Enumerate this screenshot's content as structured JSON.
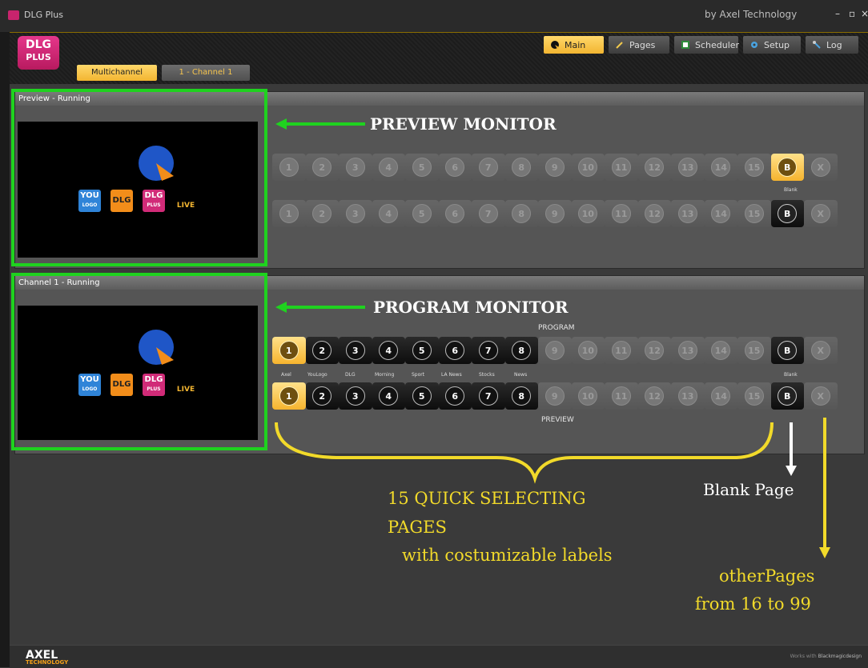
{
  "window": {
    "title": "DLG Plus",
    "by_text": "by Axel Technology",
    "min_btn": "–",
    "max_btn": "▫",
    "close_btn": "×"
  },
  "logo": {
    "line1": "DLG",
    "line2": "PLUS"
  },
  "channel_tabs": [
    "Multichannel",
    "1 - Channel 1"
  ],
  "nav": [
    "Main",
    "Pages",
    "Scheduler",
    "Setup",
    "Log"
  ],
  "preview_panel": {
    "header": "Preview - Running",
    "row1": [
      "1",
      "2",
      "3",
      "4",
      "5",
      "6",
      "7",
      "8",
      "9",
      "10",
      "11",
      "12",
      "13",
      "14",
      "15",
      "B",
      "X"
    ],
    "row2": [
      "1",
      "2",
      "3",
      "4",
      "5",
      "6",
      "7",
      "8",
      "9",
      "10",
      "11",
      "12",
      "13",
      "14",
      "15",
      "B",
      "X"
    ],
    "blank_label": "Blank"
  },
  "program_panel": {
    "header": "Channel 1 - Running",
    "program_title": "PROGRAM",
    "preview_title": "PREVIEW",
    "row1": [
      "1",
      "2",
      "3",
      "4",
      "5",
      "6",
      "7",
      "8",
      "9",
      "10",
      "11",
      "12",
      "13",
      "14",
      "15",
      "B",
      "X"
    ],
    "row2": [
      "1",
      "2",
      "3",
      "4",
      "5",
      "6",
      "7",
      "8",
      "9",
      "10",
      "11",
      "12",
      "13",
      "14",
      "15",
      "B",
      "X"
    ],
    "page_labels": [
      "Axel",
      "YouLogo",
      "DLG",
      "Morning",
      "Sport",
      "LA News",
      "Stocks",
      "News"
    ],
    "blank_label": "Blank"
  },
  "monitor_logos": {
    "you_logo": "YOU",
    "you_logo_sub": "LOGO",
    "dlg": "DLG",
    "dlg_plus": "DLG",
    "dlg_plus_sub": "PLUS",
    "live": "LIVE"
  },
  "annotations": {
    "preview_monitor": "PREVIEW MONITOR",
    "program_monitor": "PROGRAM MONITOR",
    "quick_pages_1": "15 QUICK SELECTING",
    "quick_pages_2": "PAGES",
    "quick_pages_3": "with costumizable labels",
    "blank_page": "Blank Page",
    "other_pages_1": "otherPages",
    "other_pages_2": "from 16 to 99"
  },
  "footer": {
    "brand": "AXEL",
    "brand_sub": "TECHNOLOGY",
    "works_with": "Works with",
    "works_brand": "Blackmagicdesign"
  },
  "colors": {
    "accent_yellow": "#f2b531",
    "annotation_green": "#1fd21f",
    "annotation_yellow": "#f2da2a",
    "dlg_pink": "#d12b78"
  }
}
